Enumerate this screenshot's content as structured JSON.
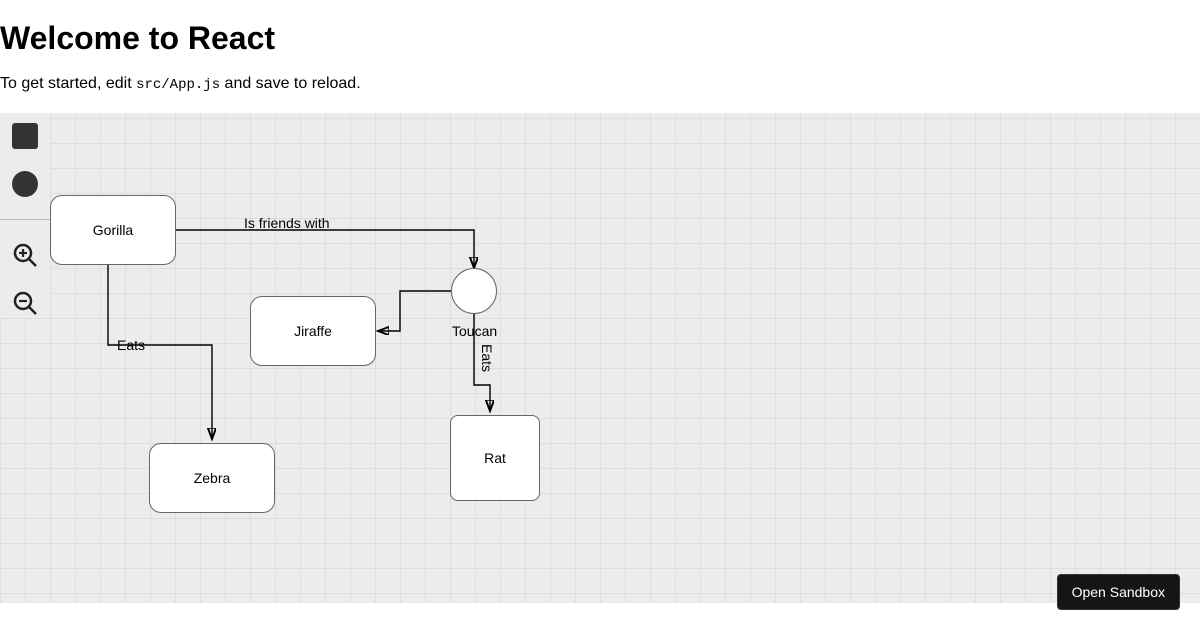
{
  "header": {
    "title": "Welcome to React",
    "intro_before": "To get started, edit ",
    "intro_code": "src/App.js",
    "intro_after": " and save to reload."
  },
  "toolbar": {
    "tools": {
      "square": "square-tool",
      "circle": "circle-tool",
      "zoom_in": "zoom-in",
      "zoom_out": "zoom-out"
    }
  },
  "diagram": {
    "nodes": {
      "gorilla": {
        "label": "Gorilla",
        "type": "rect"
      },
      "jiraffe": {
        "label": "Jiraffe",
        "type": "rect"
      },
      "zebra": {
        "label": "Zebra",
        "type": "rect"
      },
      "rat": {
        "label": "Rat",
        "type": "rect"
      },
      "toucan": {
        "label": "Toucan",
        "type": "circle"
      }
    },
    "edges": {
      "gorilla_toucan": {
        "label": "Is friends with",
        "from": "gorilla",
        "to": "toucan"
      },
      "gorilla_zebra": {
        "label": "Eats",
        "from": "gorilla",
        "to": "zebra"
      },
      "toucan_jiraffe": {
        "label": "",
        "from": "toucan",
        "to": "jiraffe"
      },
      "toucan_rat": {
        "label": "Eats",
        "from": "toucan",
        "to": "rat"
      }
    }
  },
  "footer": {
    "open_sandbox": "Open Sandbox"
  }
}
